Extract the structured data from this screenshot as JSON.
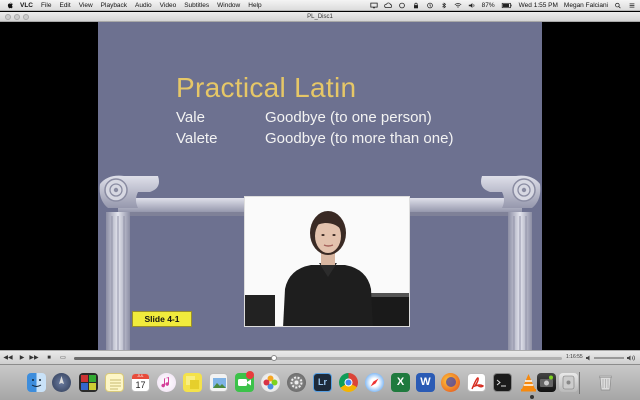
{
  "menubar": {
    "app_name": "VLC",
    "items": [
      "File",
      "Edit",
      "View",
      "Playback",
      "Audio",
      "Video",
      "Subtitles",
      "Window",
      "Help"
    ],
    "battery": "87%",
    "clock": "Wed 1:55 PM",
    "user": "Megan Falciani"
  },
  "window": {
    "title": "PL_Disc1"
  },
  "slide": {
    "title": "Practical Latin",
    "rows": [
      {
        "word": "Vale",
        "meaning": "Goodbye (to one person)"
      },
      {
        "word": "Valete",
        "meaning": "Goodbye (to more than one)"
      }
    ],
    "label": "Slide 4-1"
  },
  "controls": {
    "time": "1:16:55",
    "progress": 0.41
  },
  "dock": {
    "icons": [
      "finder-icon",
      "launchpad-icon",
      "photo-booth-icon",
      "notes-icon",
      "calendar-icon",
      "itunes-icon",
      "stickies-icon",
      "preview-icon",
      "facetime-icon",
      "messages-icon",
      "photos-icon",
      "system-preferences-icon",
      "lightroom-icon",
      "chrome-icon",
      "safari-icon",
      "excel-icon",
      "word-icon",
      "firefox-icon",
      "acrobat-icon",
      "terminal-icon",
      "vlc-icon",
      "screen-capture-icon",
      "disk-utility-icon",
      "trash-icon"
    ],
    "calendar_day": "17",
    "calendar_month": "JUL",
    "lightroom_label": "Lr",
    "excel_label": "X",
    "word_label": "W"
  }
}
